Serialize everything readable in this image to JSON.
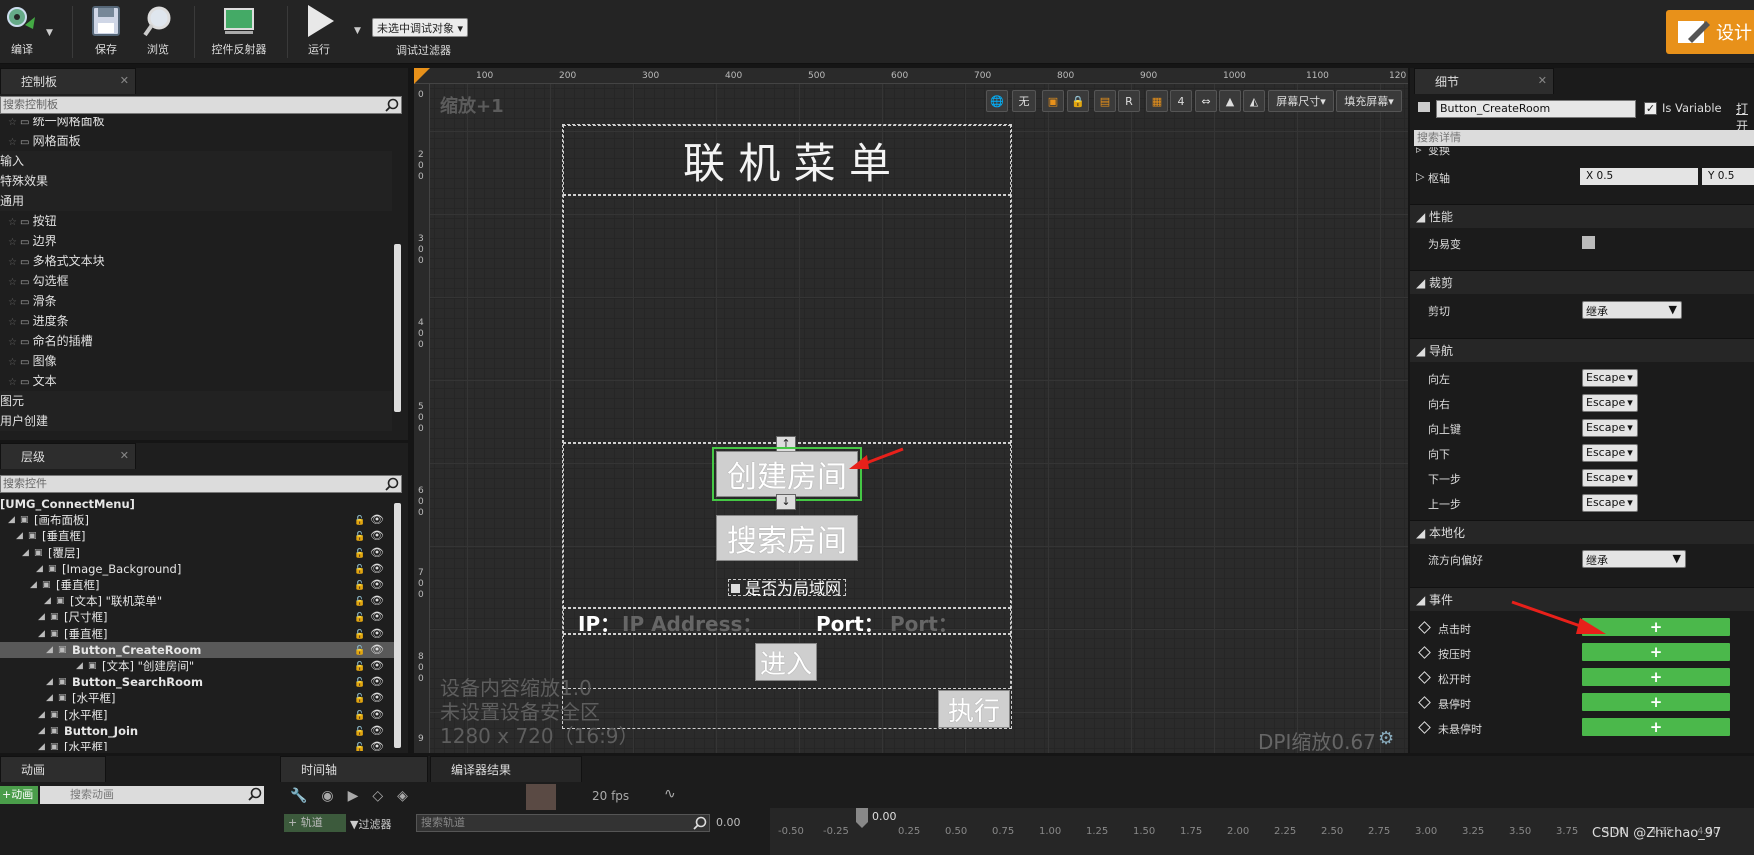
{
  "toolbar": {
    "compile": "编译",
    "save": "保存",
    "browse": "浏览",
    "widget_reflector": "控件反射器",
    "run": "运行",
    "debug_filter_value": "未选中调试对象",
    "debug_filter_label": "调试过滤器",
    "designer": "设计"
  },
  "palette": {
    "tab": "控制板",
    "search_placeholder": "搜索控制板",
    "items": [
      {
        "label": "统一网格面板",
        "kind": "item"
      },
      {
        "label": "网格面板",
        "kind": "item"
      },
      {
        "label": "输入",
        "kind": "cat"
      },
      {
        "label": "特殊效果",
        "kind": "cat"
      },
      {
        "label": "通用",
        "kind": "cat"
      },
      {
        "label": "按钮",
        "kind": "item"
      },
      {
        "label": "边界",
        "kind": "item"
      },
      {
        "label": "多格式文本块",
        "kind": "item"
      },
      {
        "label": "勾选框",
        "kind": "item"
      },
      {
        "label": "滑条",
        "kind": "item"
      },
      {
        "label": "进度条",
        "kind": "item"
      },
      {
        "label": "命名的插槽",
        "kind": "item"
      },
      {
        "label": "图像",
        "kind": "item"
      },
      {
        "label": "文本",
        "kind": "item"
      },
      {
        "label": "图元",
        "kind": "cat"
      },
      {
        "label": "用户创建",
        "kind": "cat"
      }
    ]
  },
  "hierarchy": {
    "tab": "层级",
    "search_placeholder": "搜索控件",
    "rows": [
      {
        "label": "[UMG_ConnectMenu]",
        "bold": true
      },
      {
        "label": "[画布面板]"
      },
      {
        "label": "[垂直框]"
      },
      {
        "label": "[覆层]"
      },
      {
        "label": "[Image_Background]"
      },
      {
        "label": "[垂直框]"
      },
      {
        "label": "[文本] \"联机菜单\""
      },
      {
        "label": "[尺寸框]"
      },
      {
        "label": "[垂直框]"
      },
      {
        "label": "Button_CreateRoom",
        "bold": true,
        "selected": true
      },
      {
        "label": "[文本] \"创建房间\""
      },
      {
        "label": "Button_SearchRoom",
        "bold": true
      },
      {
        "label": "[水平框]"
      },
      {
        "label": "[水平框]"
      },
      {
        "label": "Button_Join",
        "bold": true
      },
      {
        "label": "[水平框]"
      }
    ]
  },
  "canvas": {
    "zoom": "缩放+1",
    "ruler_x": [
      "100",
      "200",
      "300",
      "400",
      "500",
      "600",
      "700",
      "800",
      "900",
      "1000",
      "1100",
      "120"
    ],
    "ruler_y": [
      "0",
      "2\n0\n0",
      "3\n0\n0",
      "4\n0\n0",
      "5\n0\n0",
      "6\n0\n0",
      "7\n0\n0",
      "8\n0\n0",
      "9"
    ],
    "none_btn": "无",
    "r_btn": "R",
    "four_btn": "4",
    "screen_size": "屏幕尺寸",
    "fill_screen": "填充屏幕",
    "title": "联 机 菜 单",
    "create_room": "创建房间",
    "search_room": "搜索房间",
    "lan_label": "是否为局域网",
    "ip_label": "IP：",
    "ip_placeholder": "IP Address：",
    "port_label": "Port：",
    "port_placeholder": "Port：",
    "join": "进入",
    "execute": "执行",
    "info1": "设备内容缩放1.0",
    "info2": "未设置设备安全区",
    "info3": "1280 x 720（16:9）",
    "dpi": "DPI缩放0.67",
    "arrow_color": "#e8201a"
  },
  "details": {
    "tab": "细节",
    "name_value": "Button_CreateRoom",
    "is_variable": "Is Variable",
    "open": "打开",
    "search_placeholder": "搜索详情",
    "transform": "变换",
    "pivot": "枢轴",
    "pivot_x": "X  0.5",
    "pivot_y": "Y  0.5",
    "perf_cat": "性能",
    "volatile": "为易变",
    "clip_cat": "裁剪",
    "clipping": "剪切",
    "inherit": "继承",
    "nav_cat": "导航",
    "nav": [
      {
        "label": "向左",
        "value": "Escape"
      },
      {
        "label": "向右",
        "value": "Escape"
      },
      {
        "label": "向上键",
        "value": "Escape"
      },
      {
        "label": "向下",
        "value": "Escape"
      },
      {
        "label": "下一步",
        "value": "Escape"
      },
      {
        "label": "上一步",
        "value": "Escape"
      }
    ],
    "loc_cat": "本地化",
    "flow_dir": "流方向偏好",
    "flow_value": "继承",
    "event_cat": "事件",
    "events": [
      {
        "label": "点击时"
      },
      {
        "label": "按压时"
      },
      {
        "label": "松开时"
      },
      {
        "label": "悬停时"
      },
      {
        "label": "未悬停时"
      }
    ],
    "plus": "+",
    "accent_green": "#4bb84b"
  },
  "bottom": {
    "anim_tab": "动画",
    "anim_btn": "动画",
    "anim_search": "搜索动画",
    "timeline_tab": "时间轴",
    "compiler_tab": "编译器结果",
    "fps": "20 fps",
    "track_btn": "轨道",
    "filter": "过滤器",
    "track_search": "搜索轨道",
    "time_value": "0.00",
    "playhead": "0.00",
    "ticks": [
      "-0.50",
      "-0.25",
      "0.25",
      "0.50",
      "0.75",
      "1.00",
      "1.25",
      "1.50",
      "1.75",
      "2.00",
      "2.25",
      "2.50",
      "2.75",
      "3.00",
      "3.25",
      "3.50",
      "3.75",
      "4.00",
      "4.25",
      "4.50"
    ],
    "watermark": "CSDN @Zhichao_97"
  }
}
